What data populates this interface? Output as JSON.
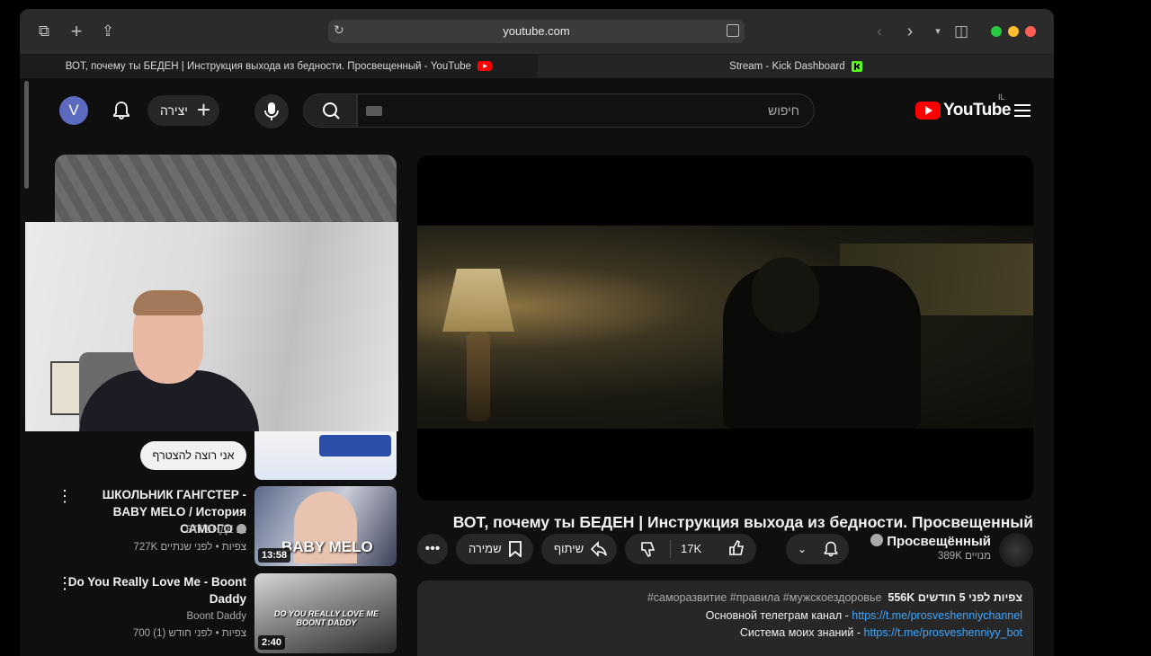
{
  "browser": {
    "url": "youtube.com",
    "tabs": [
      {
        "label": "ВОТ, почему ты БЕДЕН | Инструкция выхода из бедности. Просвещенный - YouTube",
        "active": true
      },
      {
        "label": "Stream - Kick Dashboard",
        "active": false
      }
    ],
    "traffic_colors": {
      "green": "#28c840",
      "yellow": "#febc2e",
      "red": "#ff5f57"
    }
  },
  "header": {
    "avatar_letter": "V",
    "create_label": "יצירה",
    "search_placeholder": "חיפוש",
    "logo_text": "YouTube",
    "region": "IL"
  },
  "sidebar": {
    "join_button": "אני רוצה להצטרף",
    "recommendations": [
      {
        "title": "ШКОЛЬНИК ГАНГСТЕР - BABY MELO / История САМОГО ...",
        "channel": "ВТРЕНДЕ",
        "meta": "727K צפיות • לפני שנתיים",
        "duration": "13:58",
        "thumb_caption": "BABY MELO"
      },
      {
        "title": "Do You Really Love Me - Boont Daddy",
        "channel": "Boont Daddy",
        "meta": "700 צפיות • לפני חודש (1)",
        "duration": "2:40",
        "thumb_caption": "DO YOU REALLY LOVE ME BOONT DADDY"
      }
    ]
  },
  "video": {
    "title": "ВОТ, почему ты БЕДЕН | Инструкция выхода из бедности. Просвещенный",
    "save_label": "שמירה",
    "share_label": "שיתוף",
    "likes": "17K",
    "channel_name": "Просвещённый",
    "subscribers": "389K מנויים"
  },
  "description": {
    "stats": "556K צפיות  לפני 5 חודשים",
    "tags": "#саморазвитие #правила #мужскоездоровье",
    "line1_text": "Основной телеграм канал - ",
    "line1_link": "https://t.me/prosveshenniychannel",
    "line2_text": "Система моих знаний - ",
    "line2_link": "https://t.me/prosveshenniyy_bot"
  }
}
